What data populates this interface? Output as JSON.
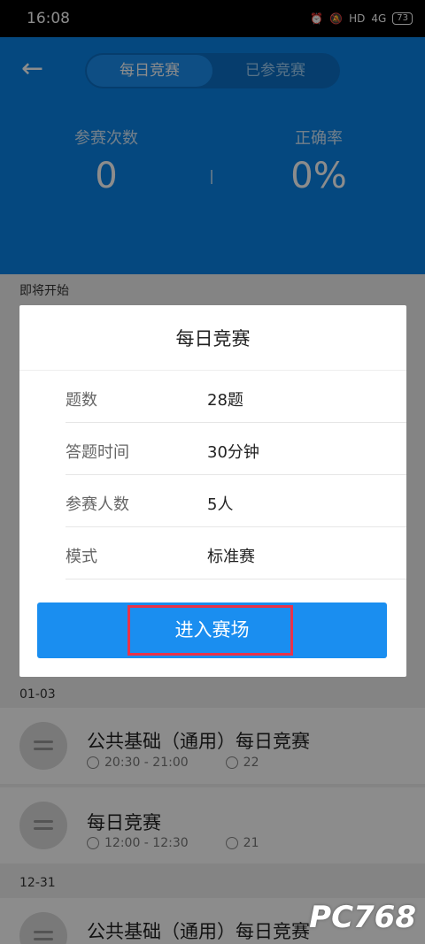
{
  "status_bar": {
    "time": "16:08",
    "network": "4G",
    "hd": "HD",
    "battery": "73"
  },
  "header": {
    "tabs": [
      "每日竞赛",
      "已参竞赛"
    ],
    "stats": [
      {
        "label": "参赛次数",
        "value": "0"
      },
      {
        "label": "正确率",
        "value": "0%"
      }
    ]
  },
  "sections": {
    "upcoming": "即将开始",
    "date_1": "01-03",
    "date_2": "12-31"
  },
  "list": [
    {
      "title": "公共基础（通用）每日竞赛",
      "time": "20:30 - 21:00",
      "count": "22"
    },
    {
      "title": "每日竞赛",
      "time": "12:00 - 12:30",
      "count": "21"
    },
    {
      "title": "公共基础（通用）每日竞赛",
      "time": "",
      "count": ""
    }
  ],
  "modal": {
    "title": "每日竞赛",
    "rows": [
      {
        "key": "题数",
        "value": "28题"
      },
      {
        "key": "答题时间",
        "value": "30分钟"
      },
      {
        "key": "参赛人数",
        "value": "5人"
      },
      {
        "key": "模式",
        "value": "标准赛"
      }
    ],
    "enter_label": "进入赛场"
  },
  "watermark": "PC768"
}
